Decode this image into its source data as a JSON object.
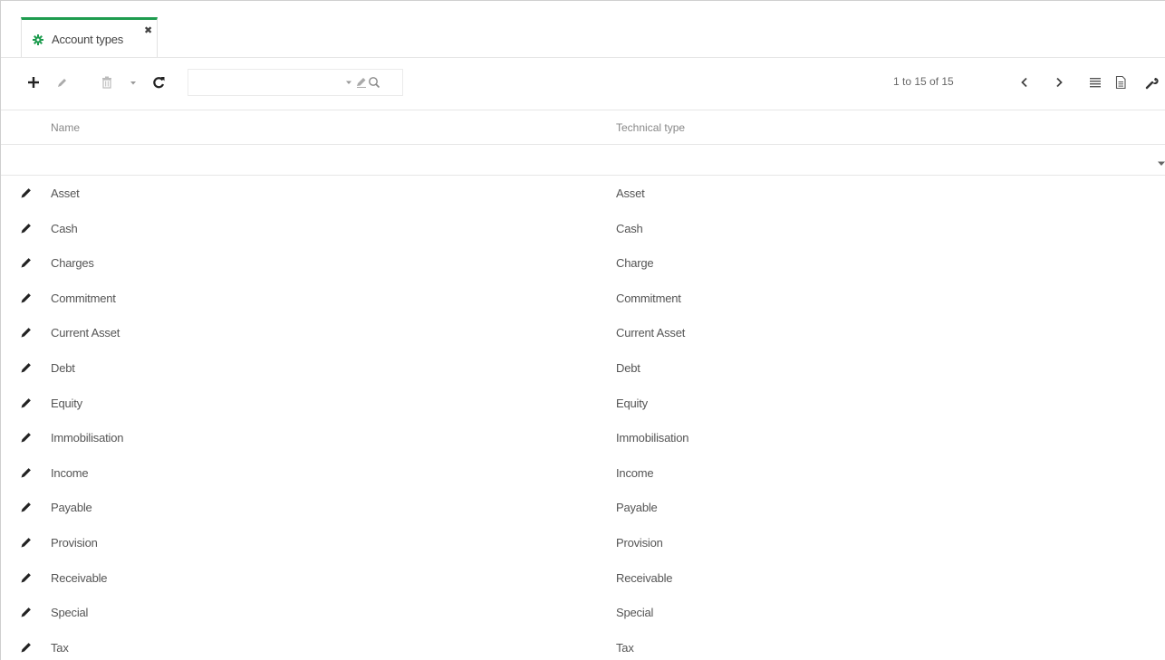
{
  "tab": {
    "title": "Account types",
    "icon": "gear-icon",
    "close_icon": "close-icon",
    "accent_color": "#1e9c4f"
  },
  "toolbar": {
    "search": {
      "value": "",
      "placeholder": ""
    },
    "pager": {
      "text": "1 to 15 of 15"
    },
    "icons": [
      "plus-icon",
      "pencil-icon",
      "trash-icon",
      "caret-down-icon",
      "refresh-icon",
      "search-icon",
      "chevron-left-icon",
      "chevron-right-icon",
      "list-icon",
      "document-icon",
      "wrench-icon"
    ]
  },
  "table": {
    "columns": [
      {
        "label": "Name"
      },
      {
        "label": "Technical type"
      }
    ],
    "rows": [
      {
        "name": "Asset",
        "type": "Asset"
      },
      {
        "name": "Cash",
        "type": "Cash"
      },
      {
        "name": "Charges",
        "type": "Charge"
      },
      {
        "name": "Commitment",
        "type": "Commitment"
      },
      {
        "name": "Current Asset",
        "type": "Current Asset"
      },
      {
        "name": "Debt",
        "type": "Debt"
      },
      {
        "name": "Equity",
        "type": "Equity"
      },
      {
        "name": "Immobilisation",
        "type": "Immobilisation"
      },
      {
        "name": "Income",
        "type": "Income"
      },
      {
        "name": "Payable",
        "type": "Payable"
      },
      {
        "name": "Provision",
        "type": "Provision"
      },
      {
        "name": "Receivable",
        "type": "Receivable"
      },
      {
        "name": "Special",
        "type": "Special"
      },
      {
        "name": "Tax",
        "type": "Tax"
      }
    ]
  }
}
